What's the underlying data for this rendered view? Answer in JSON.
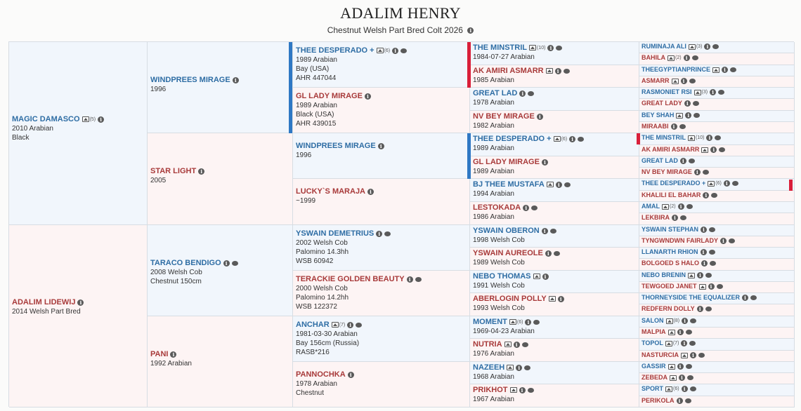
{
  "header": {
    "title": "ADALIM HENRY",
    "subtitle": "Chestnut Welsh Part Bred Colt 2026"
  },
  "gen1": [
    {
      "name": "MAGIC DAMASCO",
      "photos": "(5)",
      "lines": [
        "2010 Arabian",
        "Black"
      ]
    },
    {
      "name": "ADALIM LIDEWIJ",
      "lines": [
        "2014 Welsh Part Bred"
      ]
    }
  ],
  "gen2": [
    {
      "name": "WINDPREES MIRAGE",
      "lines": [
        "1996"
      ]
    },
    {
      "name": "STAR LIGHT",
      "lines": [
        "2005"
      ]
    },
    {
      "name": "TARACO BENDIGO",
      "lines": [
        "2008 Welsh Cob",
        "Chestnut 150cm"
      ]
    },
    {
      "name": "PANI",
      "lines": [
        "1992 Arabian"
      ]
    }
  ],
  "gen3": [
    {
      "name": "THEE DESPERADO +",
      "photos": "(6)",
      "lines": [
        "1989 Arabian",
        "Bay (USA)",
        "AHR 447044"
      ]
    },
    {
      "name": "GL LADY MIRAGE",
      "lines": [
        "1989 Arabian",
        "Black (USA)",
        "AHR 439015"
      ]
    },
    {
      "name": "WINDPREES MIRAGE",
      "lines": [
        "1996"
      ]
    },
    {
      "name": "LUCKY`S MARAJA",
      "lines": [
        "~1999"
      ]
    },
    {
      "name": "YSWAIN DEMETRIUS",
      "lines": [
        "2002 Welsh Cob",
        "Palomino 14.3hh",
        "WSB 60942"
      ]
    },
    {
      "name": "TERACKIE GOLDEN BEAUTY",
      "lines": [
        "2000 Welsh Cob",
        "Palomino 14.2hh",
        "WSB 122372"
      ]
    },
    {
      "name": "ANCHAR",
      "photos": "(7)",
      "lines": [
        "1981-03-30 Arabian",
        "Bay 156cm (Russia)",
        "RASB*216"
      ]
    },
    {
      "name": "PANNOCHKA",
      "lines": [
        "1978 Arabian",
        "Chestnut"
      ]
    }
  ],
  "gen4": [
    {
      "name": "THE MINSTRIL",
      "photos": "(10)",
      "lines": [
        "1984-07-27 Arabian"
      ]
    },
    {
      "name": "AK AMIRI ASMARR",
      "photos": "",
      "lines": [
        "1985 Arabian"
      ]
    },
    {
      "name": "GREAT LAD",
      "lines": [
        "1978 Arabian"
      ]
    },
    {
      "name": "NV BEY MIRAGE",
      "lines": [
        "1982 Arabian"
      ]
    },
    {
      "name": "THEE DESPERADO +",
      "photos": "(6)",
      "lines": [
        "1989 Arabian"
      ]
    },
    {
      "name": "GL LADY MIRAGE",
      "lines": [
        "1989 Arabian"
      ]
    },
    {
      "name": "BJ THEE MUSTAFA",
      "photos": "",
      "lines": [
        "1994 Arabian"
      ]
    },
    {
      "name": "LESTOKADA",
      "lines": [
        "1986 Arabian"
      ]
    },
    {
      "name": "YSWAIN OBERON",
      "lines": [
        "1998 Welsh Cob"
      ]
    },
    {
      "name": "YSWAIN AUREOLE",
      "lines": [
        "1989 Welsh Cob"
      ]
    },
    {
      "name": "NEBO THOMAS",
      "photos": "",
      "lines": [
        "1991 Welsh Cob"
      ]
    },
    {
      "name": "ABERLOGIN POLLY",
      "photos": "",
      "lines": [
        "1993 Welsh Cob"
      ]
    },
    {
      "name": "MOMENT",
      "photos": "(6)",
      "lines": [
        "1969-04-23 Arabian"
      ]
    },
    {
      "name": "NUTRIA",
      "photos": "",
      "lines": [
        "1976 Arabian"
      ]
    },
    {
      "name": "NAZEEH",
      "photos": "",
      "lines": [
        "1968 Arabian"
      ]
    },
    {
      "name": "PRIKHOT",
      "photos": "",
      "lines": [
        "1967 Arabian"
      ]
    }
  ],
  "gen5": [
    {
      "name": "RUMINAJA ALI",
      "photos": "(3)"
    },
    {
      "name": "BAHILA",
      "photos": "(2)"
    },
    {
      "name": "THEEGYPTIANPRINCE",
      "photos": ""
    },
    {
      "name": "ASMARR",
      "photos": ""
    },
    {
      "name": "RASMONIET RSI",
      "photos": "(3)"
    },
    {
      "name": "GREAT LADY"
    },
    {
      "name": "BEY SHAH",
      "photos": ""
    },
    {
      "name": "MIRAABI"
    },
    {
      "name": "THE MINSTRIL",
      "photos": "(10)"
    },
    {
      "name": "AK AMIRI ASMARR",
      "photos": ""
    },
    {
      "name": "GREAT LAD"
    },
    {
      "name": "NV BEY MIRAGE"
    },
    {
      "name": "THEE DESPERADO +",
      "photos": "(6)"
    },
    {
      "name": "KHALILI EL BAHAR"
    },
    {
      "name": "AMAL",
      "photos": "(2)"
    },
    {
      "name": "LEKBIRA"
    },
    {
      "name": "YSWAIN STEPHAN"
    },
    {
      "name": "TYNGWNDWN FAIRLADY"
    },
    {
      "name": "LLANARTH RHION"
    },
    {
      "name": "BOLGOED S HALO"
    },
    {
      "name": "NEBO BRENIN",
      "photos": ""
    },
    {
      "name": "TEWGOED JANET",
      "photos": ""
    },
    {
      "name": "THORNEYSIDE THE EQUALIZER"
    },
    {
      "name": "REDFERN DOLLY"
    },
    {
      "name": "SALON",
      "photos": "(8)"
    },
    {
      "name": "MALPIA",
      "photos": ""
    },
    {
      "name": "TOPOL",
      "photos": "(7)"
    },
    {
      "name": "NASTURCIA",
      "photos": ""
    },
    {
      "name": "GASSIR",
      "photos": ""
    },
    {
      "name": "ZEBEDA",
      "photos": ""
    },
    {
      "name": "SPORT",
      "photos": "(6)"
    },
    {
      "name": "PERIKOLA"
    }
  ],
  "colors": {
    "sire": "#2e6da4",
    "dam": "#a83a3a",
    "sire_bg": "#f1f6fc",
    "dam_bg": "#fdf4f4",
    "inbreed_blue": "#2f78c4",
    "inbreed_red": "#d91f3a"
  },
  "icon_names": [
    "info-icon",
    "photo-icon",
    "comment-icon"
  ]
}
